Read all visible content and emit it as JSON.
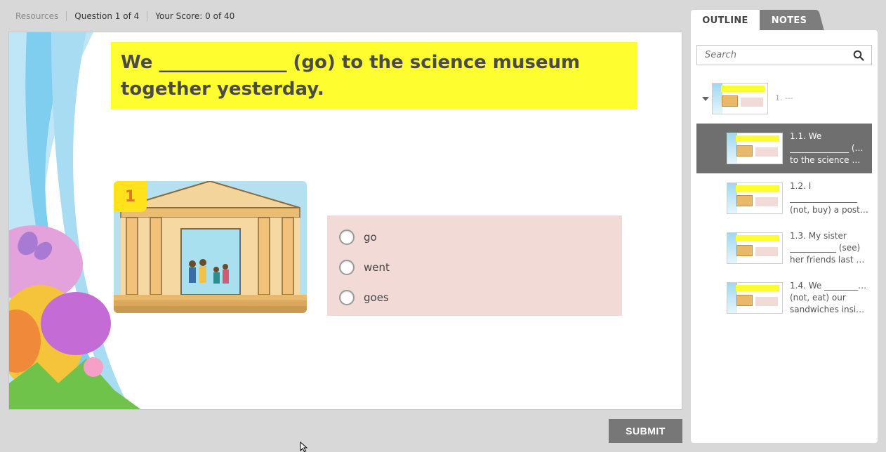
{
  "topbar": {
    "resources": "Resources",
    "question_counter": "Question 1 of 4",
    "score": "Your Score: 0 of 40"
  },
  "question": {
    "line1": "We ______________ (go) to the science museum",
    "line2": "together yesterday.",
    "image_number": "1",
    "options": [
      "go",
      "went",
      "goes"
    ]
  },
  "submit_label": "SUBMIT",
  "sidebar": {
    "tabs": {
      "outline": "OUTLINE",
      "notes": "NOTES"
    },
    "search_placeholder": "Search",
    "root_label": "1. ---",
    "items": [
      {
        "lines": [
          "1.1. We",
          "______________ (go)",
          "to the science museum together yesterday."
        ]
      },
      {
        "lines": [
          "1.2.  I",
          "________________",
          "(not, buy) a postcard"
        ]
      },
      {
        "lines": [
          "1.3. My sister",
          "___________ (see)",
          "her friends last Saturday"
        ]
      },
      {
        "lines": [
          "1.4. We ___________",
          "(not, eat) our",
          "sandwiches inside."
        ]
      }
    ]
  },
  "colors": {
    "question_bg": "#fdfd2f",
    "answers_bg": "#f2dad6",
    "submit_bg": "#777777",
    "active_item_bg": "#6f6f6f"
  }
}
